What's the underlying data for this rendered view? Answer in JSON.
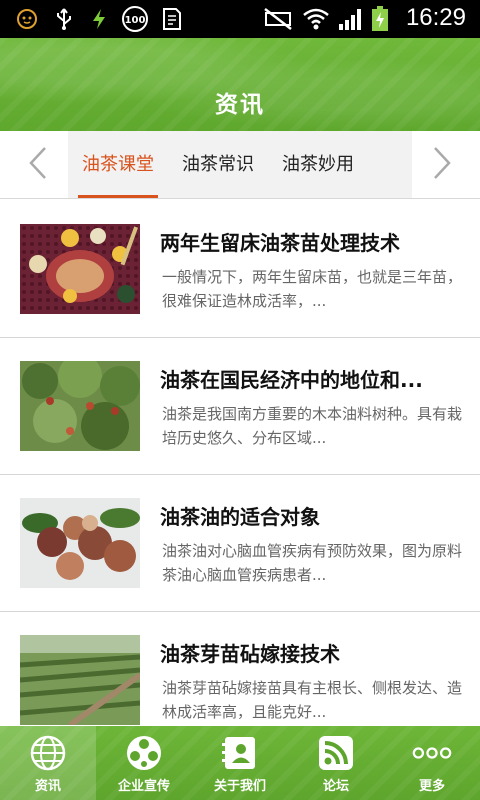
{
  "status_bar": {
    "time": "16:29",
    "battery_badge": "100",
    "icons": [
      "cat-face-icon",
      "usb-icon",
      "charging-bolt-icon",
      "battery-100-badge-icon",
      "screenshot-doc-icon",
      "silent-mode-icon",
      "wifi-icon",
      "signal-icon",
      "battery-icon"
    ]
  },
  "header": {
    "title": "资讯"
  },
  "tabs": {
    "items": [
      {
        "label": "油茶课堂",
        "active": true
      },
      {
        "label": "油茶常识",
        "active": false
      },
      {
        "label": "油茶妙用",
        "active": false
      }
    ],
    "prev_icon": "chevron-left-icon",
    "next_icon": "chevron-right-icon"
  },
  "news": [
    {
      "title": "两年生留床油茶苗处理技术",
      "summary": "一般情况下，两年生留床苗，也就是三年苗，很难保证造林成活率，..."
    },
    {
      "title": "油茶在国民经济中的地位和...",
      "summary": "油茶是我国南方重要的木本油料树种。具有栽培历史悠久、分布区域..."
    },
    {
      "title": "油茶油的适合对象",
      "summary": "油茶油对心脑血管疾病有预防效果，图为原料茶油心脑血管疾病患者..."
    },
    {
      "title": "油茶芽苗砧嫁接技术",
      "summary": "油茶芽苗砧嫁接苗具有主根长、侧根发达、造林成活率高，且能克好..."
    }
  ],
  "bottom_nav": [
    {
      "label": "资讯",
      "icon": "globe-icon",
      "active": true
    },
    {
      "label": "企业宣传",
      "icon": "film-reel-icon",
      "active": false
    },
    {
      "label": "关于我们",
      "icon": "contact-card-icon",
      "active": false
    },
    {
      "label": "论坛",
      "icon": "rss-feed-icon",
      "active": false
    },
    {
      "label": "更多",
      "icon": "more-dots-icon",
      "active": false
    }
  ],
  "colors": {
    "brand_green": "#62aa30",
    "active_tab": "#d9531e",
    "status_bar": "#000000"
  }
}
